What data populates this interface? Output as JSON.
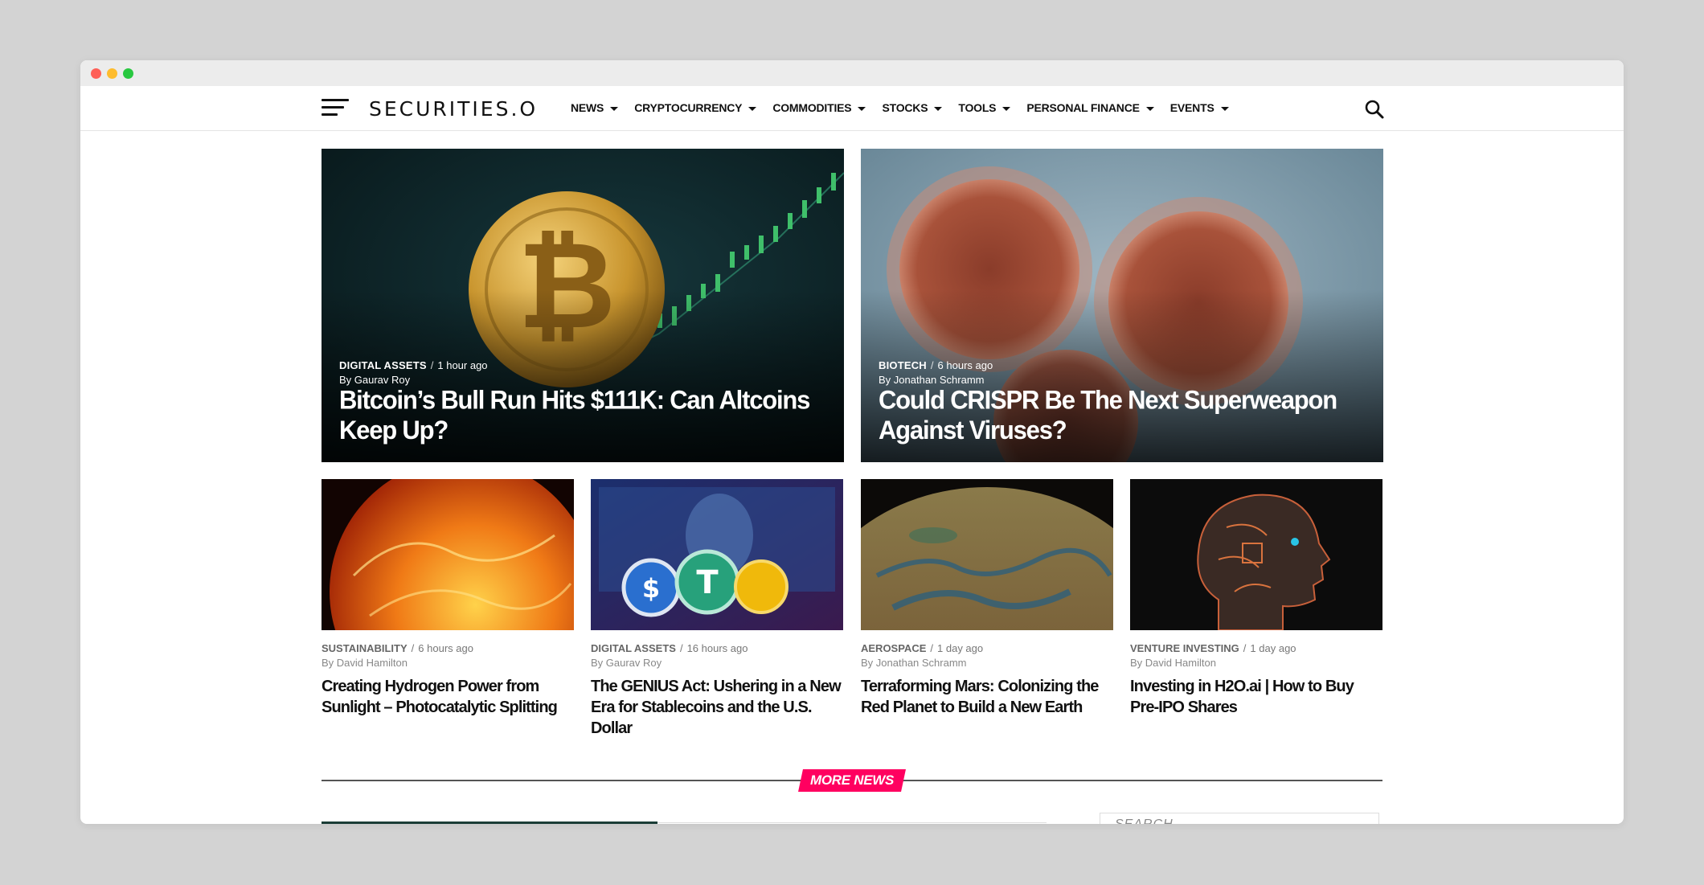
{
  "site": {
    "logo": "SECURITIES.O"
  },
  "nav": {
    "menu": [
      {
        "label": "NEWS"
      },
      {
        "label": "CRYPTOCURRENCY"
      },
      {
        "label": "COMMODITIES"
      },
      {
        "label": "STOCKS"
      },
      {
        "label": "TOOLS"
      },
      {
        "label": "PERSONAL FINANCE"
      },
      {
        "label": "EVENTS"
      }
    ]
  },
  "features": [
    {
      "category": "DIGITAL ASSETS",
      "time": "1 hour ago",
      "byline": "By Gaurav Roy",
      "headline": "Bitcoin’s Bull Run Hits $111K: Can Altcoins Keep Up?"
    },
    {
      "category": "BIOTECH",
      "time": "6 hours ago",
      "byline": "By Jonathan Schramm",
      "headline": "Could CRISPR Be The Next Superweapon Against Viruses?"
    }
  ],
  "cards": [
    {
      "category": "SUSTAINABILITY",
      "time": "6 hours ago",
      "byline": "By David Hamilton",
      "headline": "Creating Hydrogen Power from Sunlight – Photocatalytic Splitting"
    },
    {
      "category": "DIGITAL ASSETS",
      "time": "16 hours ago",
      "byline": "By Gaurav Roy",
      "headline": "The GENIUS Act: Ushering in a New Era for Stablecoins and the U.S. Dollar"
    },
    {
      "category": "AEROSPACE",
      "time": "1 day ago",
      "byline": "By Jonathan Schramm",
      "headline": "Terraforming Mars: Colonizing the Red Planet to Build a New Earth"
    },
    {
      "category": "VENTURE INVESTING",
      "time": "1 day ago",
      "byline": "By David Hamilton",
      "headline": "Investing in H2O.ai | How to Buy Pre-IPO Shares"
    }
  ],
  "more_news": {
    "label": "MORE NEWS"
  },
  "sidebar": {
    "search_placeholder": "SEARCH"
  },
  "colors": {
    "accent": "#ff0060",
    "text": "#111111"
  }
}
